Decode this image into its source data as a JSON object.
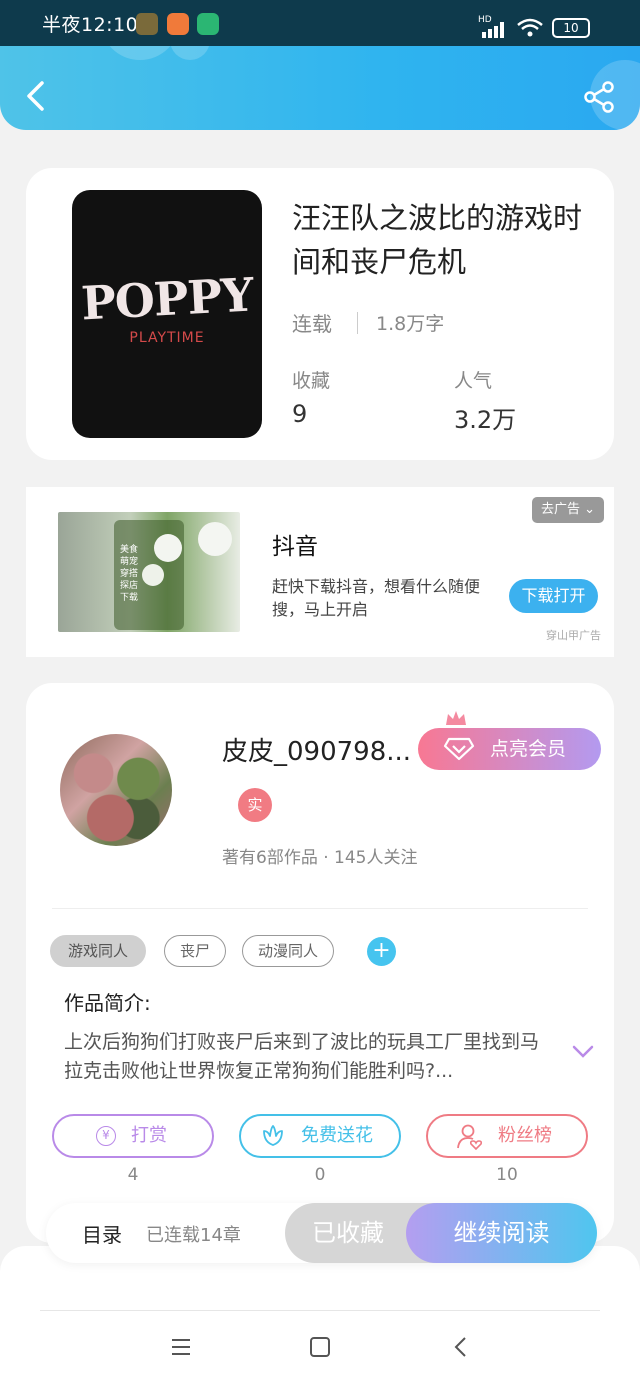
{
  "status_bar": {
    "time": "半夜12:10",
    "battery": "10",
    "network": "HD"
  },
  "book": {
    "title": "汪汪队之波比的游戏时间和丧尸危机",
    "status": "连载",
    "word_count": "1.8万字",
    "favorites_label": "收藏",
    "favorites_value": "9",
    "popularity_label": "人气",
    "popularity_value": "3.2万",
    "cover_text_main": "POPPY",
    "cover_text_sub": "PLAYTIME"
  },
  "ad": {
    "title": "抖音",
    "description": "赶快下载抖音，想看什么随便搜，马上开启",
    "button": "下载打开",
    "remove": "去广告",
    "source": "穿山甲广告",
    "image_lines": [
      "美食",
      "萌宠",
      "穿搭",
      "探店",
      "下载"
    ]
  },
  "author": {
    "name": "皮皮_090798...",
    "vip_button": "点亮会员",
    "real_badge": "实",
    "meta": "著有6部作品 · 145人关注"
  },
  "tags": [
    "游戏同人",
    "丧尸",
    "动漫同人"
  ],
  "tags_add": "+",
  "intro": {
    "title": "作品简介:",
    "text": "上次后狗狗们打败丧尸后来到了波比的玩具工厂里找到马拉克击败他让世界恢复正常狗狗们能胜利吗?..."
  },
  "actions": [
    {
      "label": "打赏",
      "count": "4",
      "color": "#b98ae8"
    },
    {
      "label": "免费送花",
      "count": "0",
      "color": "#44c0e8"
    },
    {
      "label": "粉丝榜",
      "count": "10",
      "color": "#ef7b84"
    }
  ],
  "bottom_bar": {
    "toc": "目录",
    "toc_sub": "已连载14章",
    "collected": "已收藏",
    "continue": "继续阅读"
  }
}
